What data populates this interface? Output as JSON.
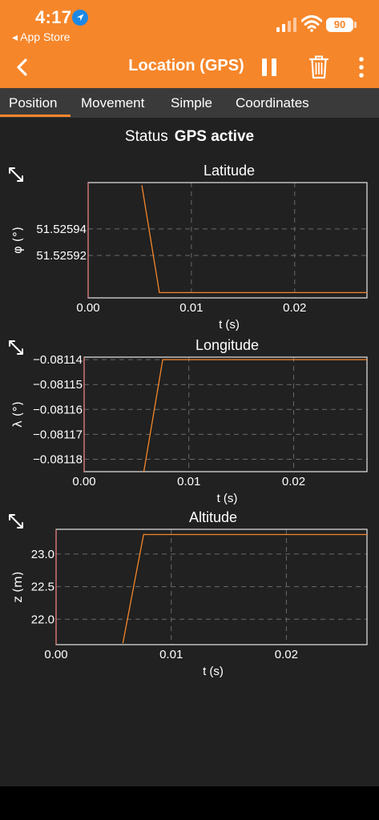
{
  "status_bar": {
    "time": "4:17",
    "back_label": "◂ App Store",
    "battery": "90"
  },
  "header": {
    "title": "Location (GPS)"
  },
  "tabs": [
    {
      "label": "Position",
      "active": true
    },
    {
      "label": "Movement"
    },
    {
      "label": "Simple"
    },
    {
      "label": "Coordinates"
    }
  ],
  "status": {
    "label": "Status",
    "value": "GPS active"
  },
  "colors": {
    "accent": "#f6862a",
    "background": "#212121",
    "tabbar": "#3a3a3a"
  },
  "chart_data": [
    {
      "type": "line",
      "title": "Latitude",
      "xlabel": "t (s)",
      "ylabel": "φ (°)",
      "xlim": [
        0.0,
        0.027
      ],
      "ylim": [
        51.525888,
        51.525975
      ],
      "xticks": [
        "0.00",
        "0.01",
        "0.02"
      ],
      "xtick_values": [
        0.0,
        0.01,
        0.02
      ],
      "yticks": [
        "51.52592",
        "51.52594"
      ],
      "ytick_values": [
        51.52592,
        51.52594
      ],
      "series": [
        {
          "x": [
            0.0052,
            0.0069,
            0.027
          ],
          "y": [
            51.525973,
            51.525892,
            51.525892
          ]
        }
      ],
      "grid": true
    },
    {
      "type": "line",
      "title": "Longitude",
      "xlabel": "t (s)",
      "ylabel": "λ (°)",
      "xlim": [
        0.0,
        0.027
      ],
      "ylim": [
        -0.081185,
        -0.081139
      ],
      "xticks": [
        "0.00",
        "0.01",
        "0.02"
      ],
      "xtick_values": [
        0.0,
        0.01,
        0.02
      ],
      "yticks": [
        "−0.08114",
        "−0.08115",
        "−0.08116",
        "−0.08117",
        "−0.08118"
      ],
      "ytick_values": [
        -0.08114,
        -0.08115,
        -0.08116,
        -0.08117,
        -0.08118
      ],
      "series": [
        {
          "x": [
            0.0057,
            0.0075,
            0.027
          ],
          "y": [
            -0.081185,
            -0.08114,
            -0.08114
          ]
        }
      ],
      "grid": true
    },
    {
      "type": "line",
      "title": "Altitude",
      "xlabel": "t (s)",
      "ylabel": "z (m)",
      "xlim": [
        0.0,
        0.027
      ],
      "ylim": [
        21.61,
        23.38
      ],
      "xticks": [
        "0.00",
        "0.01",
        "0.02"
      ],
      "xtick_values": [
        0.0,
        0.01,
        0.02
      ],
      "yticks": [
        "23.0",
        "22.5",
        "22.0"
      ],
      "ytick_values": [
        23.0,
        22.5,
        22.0
      ],
      "series": [
        {
          "x": [
            0.0058,
            0.0076,
            0.027
          ],
          "y": [
            21.63,
            23.3,
            23.3
          ]
        }
      ],
      "grid": true
    }
  ]
}
